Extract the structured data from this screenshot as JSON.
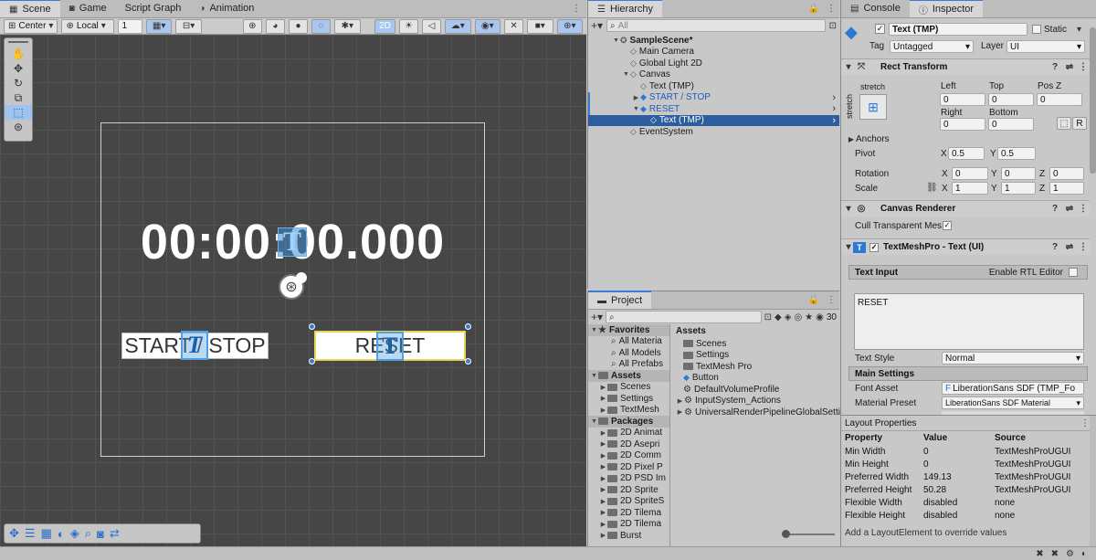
{
  "scene": {
    "tabs": [
      {
        "label": "Scene",
        "icon": "grid-icon"
      },
      {
        "label": "Game",
        "icon": "gamepad-icon"
      },
      {
        "label": "Script Graph",
        "icon": ""
      },
      {
        "label": "Animation",
        "icon": "animation-icon"
      }
    ],
    "toolbar": {
      "pivot": "Center",
      "space": "Local",
      "snap": "1",
      "mode_2d": "2D"
    },
    "timer_text": "00:00:00.000",
    "start_stop_label": "START / STOP",
    "reset_label": "RESET"
  },
  "hierarchy": {
    "tab": "Hierarchy",
    "search_placeholder": "All",
    "items": [
      {
        "label": "SampleScene*",
        "depth": 0,
        "arrow": "▼",
        "icon": "unity-icon",
        "bold": true
      },
      {
        "label": "Main Camera",
        "depth": 1,
        "arrow": "",
        "icon": "cube-icon"
      },
      {
        "label": "Global Light 2D",
        "depth": 1,
        "arrow": "",
        "icon": "cube-icon"
      },
      {
        "label": "Canvas",
        "depth": 1,
        "arrow": "▼",
        "icon": "cube-icon"
      },
      {
        "label": "Text (TMP)",
        "depth": 2,
        "arrow": "",
        "icon": "cube-icon"
      },
      {
        "label": "START / STOP",
        "depth": 2,
        "arrow": "▶",
        "icon": "prefab-icon",
        "blue": true
      },
      {
        "label": "RESET",
        "depth": 2,
        "arrow": "▼",
        "icon": "prefab-icon",
        "blue": true
      },
      {
        "label": "Text (TMP)",
        "depth": 3,
        "arrow": "",
        "icon": "cube-icon",
        "selected": true
      },
      {
        "label": "EventSystem",
        "depth": 1,
        "arrow": "",
        "icon": "cube-icon"
      }
    ]
  },
  "project": {
    "tab": "Project",
    "count": "30",
    "favorites_label": "Favorites",
    "favorites": [
      "All Materia",
      "All Models",
      "All Prefabs"
    ],
    "assets_label": "Assets",
    "assets_tree": [
      "Scenes",
      "Settings",
      "TextMesh"
    ],
    "packages_label": "Packages",
    "packages": [
      "2D Animat",
      "2D Asepri",
      "2D Comm",
      "2D Pixel P",
      "2D PSD Im",
      "2D Sprite",
      "2D SpriteS",
      "2D Tilema",
      "2D Tilema",
      "Burst"
    ],
    "content_header": "Assets",
    "content": [
      {
        "label": "Scenes",
        "icon": "folder-icon"
      },
      {
        "label": "Settings",
        "icon": "folder-icon"
      },
      {
        "label": "TextMesh Pro",
        "icon": "folder-icon"
      },
      {
        "label": "Button",
        "icon": "prefab-icon"
      },
      {
        "label": "DefaultVolumeProfile",
        "icon": "asset-icon"
      },
      {
        "label": "InputSystem_Actions",
        "icon": "asset-icon"
      },
      {
        "label": "UniversalRenderPipelineGlobalSetti",
        "icon": "asset-icon"
      }
    ]
  },
  "inspector": {
    "tabs": [
      "Console",
      "Inspector"
    ],
    "object_name": "Text (TMP)",
    "static_label": "Static",
    "tag_label": "Tag",
    "tag_value": "Untagged",
    "layer_label": "Layer",
    "layer_value": "UI",
    "rect": {
      "title": "Rect Transform",
      "anchor_preset": "stretch",
      "left_label": "Left",
      "top_label": "Top",
      "posz_label": "Pos Z",
      "left": "0",
      "top": "0",
      "posz": "0",
      "right_label": "Right",
      "bottom_label": "Bottom",
      "right": "0",
      "bottom": "0",
      "anchors_label": "Anchors",
      "pivot_label": "Pivot",
      "pivot_x": "0.5",
      "pivot_y": "0.5",
      "rotation_label": "Rotation",
      "rot_x": "0",
      "rot_y": "0",
      "rot_z": "0",
      "scale_label": "Scale",
      "scale_x": "1",
      "scale_y": "1",
      "scale_z": "1",
      "r_button": "R"
    },
    "canvas_renderer": {
      "title": "Canvas Renderer",
      "cull_label": "Cull Transparent Mes"
    },
    "tmp": {
      "title": "TextMeshPro - Text (UI)",
      "text_input_label": "Text Input",
      "rtl_label": "Enable RTL Editor",
      "text_value": "RESET",
      "text_style_label": "Text Style",
      "text_style_value": "Normal",
      "main_settings_label": "Main Settings",
      "font_asset_label": "Font Asset",
      "font_asset_value": "LiberationSans SDF (TMP_Fo",
      "material_label": "Material Preset",
      "material_value": "LiberationSans SDF Material"
    },
    "layout": {
      "title": "Layout Properties",
      "headers": [
        "Property",
        "Value",
        "Source"
      ],
      "rows": [
        [
          "Min Width",
          "0",
          "TextMeshProUGUI"
        ],
        [
          "Min Height",
          "0",
          "TextMeshProUGUI"
        ],
        [
          "Preferred Width",
          "149.13",
          "TextMeshProUGUI"
        ],
        [
          "Preferred Height",
          "50.28",
          "TextMeshProUGUI"
        ],
        [
          "Flexible Width",
          "disabled",
          "none"
        ],
        [
          "Flexible Height",
          "disabled",
          "none"
        ]
      ],
      "footer": "Add a LayoutElement to override values"
    }
  },
  "colors": {
    "accent": "#3a7bd5",
    "selection": "#2c5d9e",
    "scene_bg": "#464646"
  }
}
